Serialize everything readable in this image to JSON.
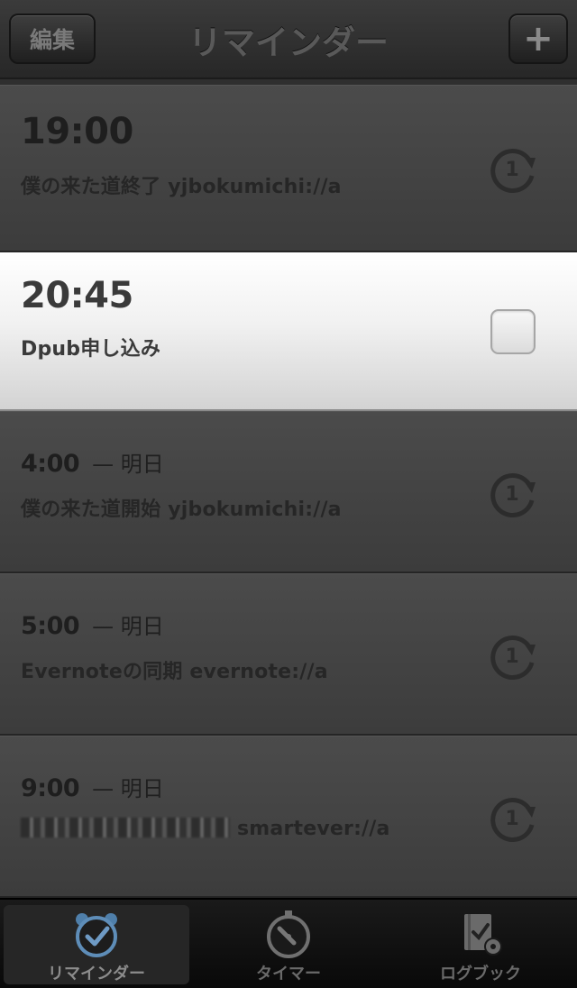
{
  "header": {
    "title": "リマインダー",
    "edit_label": "編集",
    "add_label": "+"
  },
  "reminders": [
    {
      "time": "19:00",
      "day": "",
      "title": "僕の来た道終了 yjbokumichi://a",
      "status": "repeat-icon"
    },
    {
      "time": "20:45",
      "day": "",
      "title": "Dpub申し込み",
      "status": "checkbox"
    },
    {
      "time": "4:00",
      "day": "— 明日",
      "title": "僕の来た道開始 yjbokumichi://a",
      "status": "repeat-icon"
    },
    {
      "time": "5:00",
      "day": "— 明日",
      "title": "Evernoteの同期 evernote://a",
      "status": "repeat-icon"
    },
    {
      "time": "9:00",
      "day": "— 明日",
      "title": "smartever://a",
      "status": "repeat-icon"
    }
  ],
  "tabs": [
    {
      "label": "リマインダー",
      "icon": "alarm-clock-icon",
      "selected": true
    },
    {
      "label": "タイマー",
      "icon": "stopwatch-icon",
      "selected": false
    },
    {
      "label": "ログブック",
      "icon": "logbook-icon",
      "selected": false
    }
  ],
  "colors": {
    "background": "#2f2f2f",
    "active_row": "#f1f1f1",
    "tab_selected": "#262626"
  }
}
